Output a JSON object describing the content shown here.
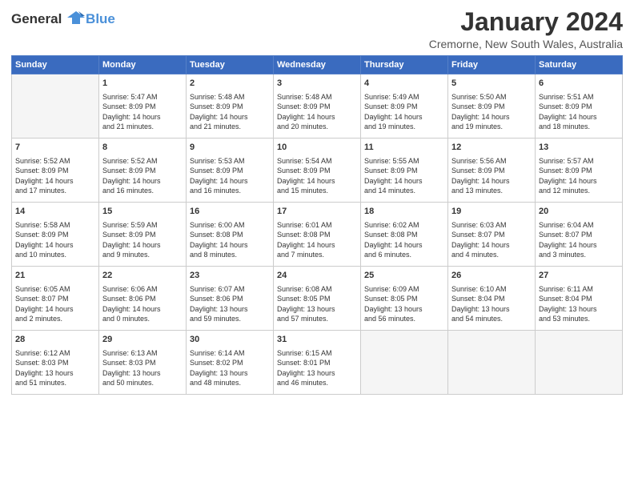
{
  "header": {
    "logo_line1": "General",
    "logo_line2": "Blue",
    "month_title": "January 2024",
    "location": "Cremorne, New South Wales, Australia"
  },
  "weekdays": [
    "Sunday",
    "Monday",
    "Tuesday",
    "Wednesday",
    "Thursday",
    "Friday",
    "Saturday"
  ],
  "weeks": [
    [
      {
        "day": "",
        "info": ""
      },
      {
        "day": "1",
        "info": "Sunrise: 5:47 AM\nSunset: 8:09 PM\nDaylight: 14 hours\nand 21 minutes."
      },
      {
        "day": "2",
        "info": "Sunrise: 5:48 AM\nSunset: 8:09 PM\nDaylight: 14 hours\nand 21 minutes."
      },
      {
        "day": "3",
        "info": "Sunrise: 5:48 AM\nSunset: 8:09 PM\nDaylight: 14 hours\nand 20 minutes."
      },
      {
        "day": "4",
        "info": "Sunrise: 5:49 AM\nSunset: 8:09 PM\nDaylight: 14 hours\nand 19 minutes."
      },
      {
        "day": "5",
        "info": "Sunrise: 5:50 AM\nSunset: 8:09 PM\nDaylight: 14 hours\nand 19 minutes."
      },
      {
        "day": "6",
        "info": "Sunrise: 5:51 AM\nSunset: 8:09 PM\nDaylight: 14 hours\nand 18 minutes."
      }
    ],
    [
      {
        "day": "7",
        "info": "Sunrise: 5:52 AM\nSunset: 8:09 PM\nDaylight: 14 hours\nand 17 minutes."
      },
      {
        "day": "8",
        "info": "Sunrise: 5:52 AM\nSunset: 8:09 PM\nDaylight: 14 hours\nand 16 minutes."
      },
      {
        "day": "9",
        "info": "Sunrise: 5:53 AM\nSunset: 8:09 PM\nDaylight: 14 hours\nand 16 minutes."
      },
      {
        "day": "10",
        "info": "Sunrise: 5:54 AM\nSunset: 8:09 PM\nDaylight: 14 hours\nand 15 minutes."
      },
      {
        "day": "11",
        "info": "Sunrise: 5:55 AM\nSunset: 8:09 PM\nDaylight: 14 hours\nand 14 minutes."
      },
      {
        "day": "12",
        "info": "Sunrise: 5:56 AM\nSunset: 8:09 PM\nDaylight: 14 hours\nand 13 minutes."
      },
      {
        "day": "13",
        "info": "Sunrise: 5:57 AM\nSunset: 8:09 PM\nDaylight: 14 hours\nand 12 minutes."
      }
    ],
    [
      {
        "day": "14",
        "info": "Sunrise: 5:58 AM\nSunset: 8:09 PM\nDaylight: 14 hours\nand 10 minutes."
      },
      {
        "day": "15",
        "info": "Sunrise: 5:59 AM\nSunset: 8:09 PM\nDaylight: 14 hours\nand 9 minutes."
      },
      {
        "day": "16",
        "info": "Sunrise: 6:00 AM\nSunset: 8:08 PM\nDaylight: 14 hours\nand 8 minutes."
      },
      {
        "day": "17",
        "info": "Sunrise: 6:01 AM\nSunset: 8:08 PM\nDaylight: 14 hours\nand 7 minutes."
      },
      {
        "day": "18",
        "info": "Sunrise: 6:02 AM\nSunset: 8:08 PM\nDaylight: 14 hours\nand 6 minutes."
      },
      {
        "day": "19",
        "info": "Sunrise: 6:03 AM\nSunset: 8:07 PM\nDaylight: 14 hours\nand 4 minutes."
      },
      {
        "day": "20",
        "info": "Sunrise: 6:04 AM\nSunset: 8:07 PM\nDaylight: 14 hours\nand 3 minutes."
      }
    ],
    [
      {
        "day": "21",
        "info": "Sunrise: 6:05 AM\nSunset: 8:07 PM\nDaylight: 14 hours\nand 2 minutes."
      },
      {
        "day": "22",
        "info": "Sunrise: 6:06 AM\nSunset: 8:06 PM\nDaylight: 14 hours\nand 0 minutes."
      },
      {
        "day": "23",
        "info": "Sunrise: 6:07 AM\nSunset: 8:06 PM\nDaylight: 13 hours\nand 59 minutes."
      },
      {
        "day": "24",
        "info": "Sunrise: 6:08 AM\nSunset: 8:05 PM\nDaylight: 13 hours\nand 57 minutes."
      },
      {
        "day": "25",
        "info": "Sunrise: 6:09 AM\nSunset: 8:05 PM\nDaylight: 13 hours\nand 56 minutes."
      },
      {
        "day": "26",
        "info": "Sunrise: 6:10 AM\nSunset: 8:04 PM\nDaylight: 13 hours\nand 54 minutes."
      },
      {
        "day": "27",
        "info": "Sunrise: 6:11 AM\nSunset: 8:04 PM\nDaylight: 13 hours\nand 53 minutes."
      }
    ],
    [
      {
        "day": "28",
        "info": "Sunrise: 6:12 AM\nSunset: 8:03 PM\nDaylight: 13 hours\nand 51 minutes."
      },
      {
        "day": "29",
        "info": "Sunrise: 6:13 AM\nSunset: 8:03 PM\nDaylight: 13 hours\nand 50 minutes."
      },
      {
        "day": "30",
        "info": "Sunrise: 6:14 AM\nSunset: 8:02 PM\nDaylight: 13 hours\nand 48 minutes."
      },
      {
        "day": "31",
        "info": "Sunrise: 6:15 AM\nSunset: 8:01 PM\nDaylight: 13 hours\nand 46 minutes."
      },
      {
        "day": "",
        "info": ""
      },
      {
        "day": "",
        "info": ""
      },
      {
        "day": "",
        "info": ""
      }
    ]
  ]
}
